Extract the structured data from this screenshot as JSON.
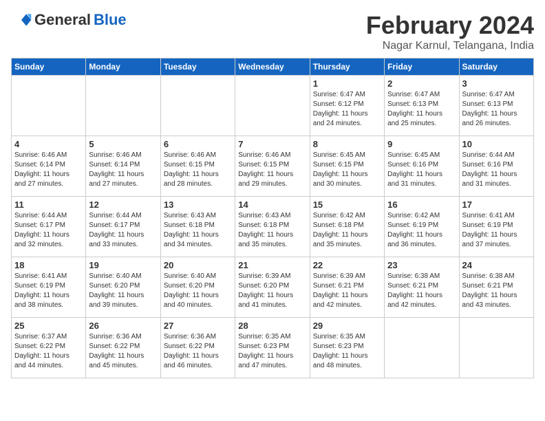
{
  "header": {
    "logo_general": "General",
    "logo_blue": "Blue",
    "month": "February 2024",
    "location": "Nagar Karnul, Telangana, India"
  },
  "weekdays": [
    "Sunday",
    "Monday",
    "Tuesday",
    "Wednesday",
    "Thursday",
    "Friday",
    "Saturday"
  ],
  "weeks": [
    [
      {
        "day": "",
        "info": ""
      },
      {
        "day": "",
        "info": ""
      },
      {
        "day": "",
        "info": ""
      },
      {
        "day": "",
        "info": ""
      },
      {
        "day": "1",
        "info": "Sunrise: 6:47 AM\nSunset: 6:12 PM\nDaylight: 11 hours\nand 24 minutes."
      },
      {
        "day": "2",
        "info": "Sunrise: 6:47 AM\nSunset: 6:13 PM\nDaylight: 11 hours\nand 25 minutes."
      },
      {
        "day": "3",
        "info": "Sunrise: 6:47 AM\nSunset: 6:13 PM\nDaylight: 11 hours\nand 26 minutes."
      }
    ],
    [
      {
        "day": "4",
        "info": "Sunrise: 6:46 AM\nSunset: 6:14 PM\nDaylight: 11 hours\nand 27 minutes."
      },
      {
        "day": "5",
        "info": "Sunrise: 6:46 AM\nSunset: 6:14 PM\nDaylight: 11 hours\nand 27 minutes."
      },
      {
        "day": "6",
        "info": "Sunrise: 6:46 AM\nSunset: 6:15 PM\nDaylight: 11 hours\nand 28 minutes."
      },
      {
        "day": "7",
        "info": "Sunrise: 6:46 AM\nSunset: 6:15 PM\nDaylight: 11 hours\nand 29 minutes."
      },
      {
        "day": "8",
        "info": "Sunrise: 6:45 AM\nSunset: 6:15 PM\nDaylight: 11 hours\nand 30 minutes."
      },
      {
        "day": "9",
        "info": "Sunrise: 6:45 AM\nSunset: 6:16 PM\nDaylight: 11 hours\nand 31 minutes."
      },
      {
        "day": "10",
        "info": "Sunrise: 6:44 AM\nSunset: 6:16 PM\nDaylight: 11 hours\nand 31 minutes."
      }
    ],
    [
      {
        "day": "11",
        "info": "Sunrise: 6:44 AM\nSunset: 6:17 PM\nDaylight: 11 hours\nand 32 minutes."
      },
      {
        "day": "12",
        "info": "Sunrise: 6:44 AM\nSunset: 6:17 PM\nDaylight: 11 hours\nand 33 minutes."
      },
      {
        "day": "13",
        "info": "Sunrise: 6:43 AM\nSunset: 6:18 PM\nDaylight: 11 hours\nand 34 minutes."
      },
      {
        "day": "14",
        "info": "Sunrise: 6:43 AM\nSunset: 6:18 PM\nDaylight: 11 hours\nand 35 minutes."
      },
      {
        "day": "15",
        "info": "Sunrise: 6:42 AM\nSunset: 6:18 PM\nDaylight: 11 hours\nand 35 minutes."
      },
      {
        "day": "16",
        "info": "Sunrise: 6:42 AM\nSunset: 6:19 PM\nDaylight: 11 hours\nand 36 minutes."
      },
      {
        "day": "17",
        "info": "Sunrise: 6:41 AM\nSunset: 6:19 PM\nDaylight: 11 hours\nand 37 minutes."
      }
    ],
    [
      {
        "day": "18",
        "info": "Sunrise: 6:41 AM\nSunset: 6:19 PM\nDaylight: 11 hours\nand 38 minutes."
      },
      {
        "day": "19",
        "info": "Sunrise: 6:40 AM\nSunset: 6:20 PM\nDaylight: 11 hours\nand 39 minutes."
      },
      {
        "day": "20",
        "info": "Sunrise: 6:40 AM\nSunset: 6:20 PM\nDaylight: 11 hours\nand 40 minutes."
      },
      {
        "day": "21",
        "info": "Sunrise: 6:39 AM\nSunset: 6:20 PM\nDaylight: 11 hours\nand 41 minutes."
      },
      {
        "day": "22",
        "info": "Sunrise: 6:39 AM\nSunset: 6:21 PM\nDaylight: 11 hours\nand 42 minutes."
      },
      {
        "day": "23",
        "info": "Sunrise: 6:38 AM\nSunset: 6:21 PM\nDaylight: 11 hours\nand 42 minutes."
      },
      {
        "day": "24",
        "info": "Sunrise: 6:38 AM\nSunset: 6:21 PM\nDaylight: 11 hours\nand 43 minutes."
      }
    ],
    [
      {
        "day": "25",
        "info": "Sunrise: 6:37 AM\nSunset: 6:22 PM\nDaylight: 11 hours\nand 44 minutes."
      },
      {
        "day": "26",
        "info": "Sunrise: 6:36 AM\nSunset: 6:22 PM\nDaylight: 11 hours\nand 45 minutes."
      },
      {
        "day": "27",
        "info": "Sunrise: 6:36 AM\nSunset: 6:22 PM\nDaylight: 11 hours\nand 46 minutes."
      },
      {
        "day": "28",
        "info": "Sunrise: 6:35 AM\nSunset: 6:23 PM\nDaylight: 11 hours\nand 47 minutes."
      },
      {
        "day": "29",
        "info": "Sunrise: 6:35 AM\nSunset: 6:23 PM\nDaylight: 11 hours\nand 48 minutes."
      },
      {
        "day": "",
        "info": ""
      },
      {
        "day": "",
        "info": ""
      }
    ]
  ]
}
